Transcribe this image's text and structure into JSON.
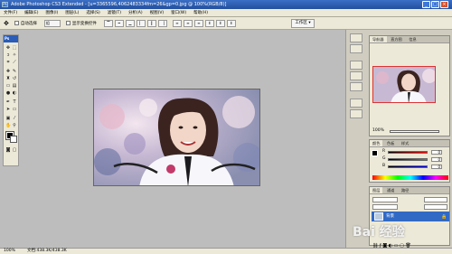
{
  "window": {
    "title": "Adobe Photoshop CS3 Extended - [u=3365596,4062483334fm=26&gp=0.jpg @ 100%(RGB/8)]",
    "logo_text": "Ps",
    "minimize": "_",
    "maximize": "□",
    "close": "×"
  },
  "menu": {
    "items": [
      "文件(F)",
      "编辑(E)",
      "图像(I)",
      "图层(L)",
      "选择(S)",
      "滤镜(T)",
      "分析(A)",
      "视图(V)",
      "窗口(W)",
      "帮助(H)"
    ]
  },
  "options": {
    "tool_icon": "move-tool-icon",
    "auto_select_label": "自动选择",
    "auto_select_value": "组",
    "show_transform_label": "显示变换控件",
    "workspace_label": "工作区 ▾"
  },
  "toolbox": {
    "header": "Ps"
  },
  "navigator": {
    "tabs": [
      "导航器",
      "直方图",
      "信息"
    ],
    "zoom": "100%"
  },
  "color_panel": {
    "tabs": [
      "颜色",
      "色板",
      "样式"
    ],
    "channels": [
      {
        "label": "R",
        "value": "0",
        "color": "#cc0000"
      },
      {
        "label": "G",
        "value": "0",
        "color": "#00aa00"
      },
      {
        "label": "B",
        "value": "0",
        "color": "#0000cc"
      }
    ]
  },
  "layers_panel": {
    "tabs": [
      "图层",
      "通道",
      "路径"
    ],
    "layer_name": "背景"
  },
  "status": {
    "zoom": "100%",
    "doc": "文档:438.3K/438.3K"
  },
  "watermark": "Bai 经验"
}
